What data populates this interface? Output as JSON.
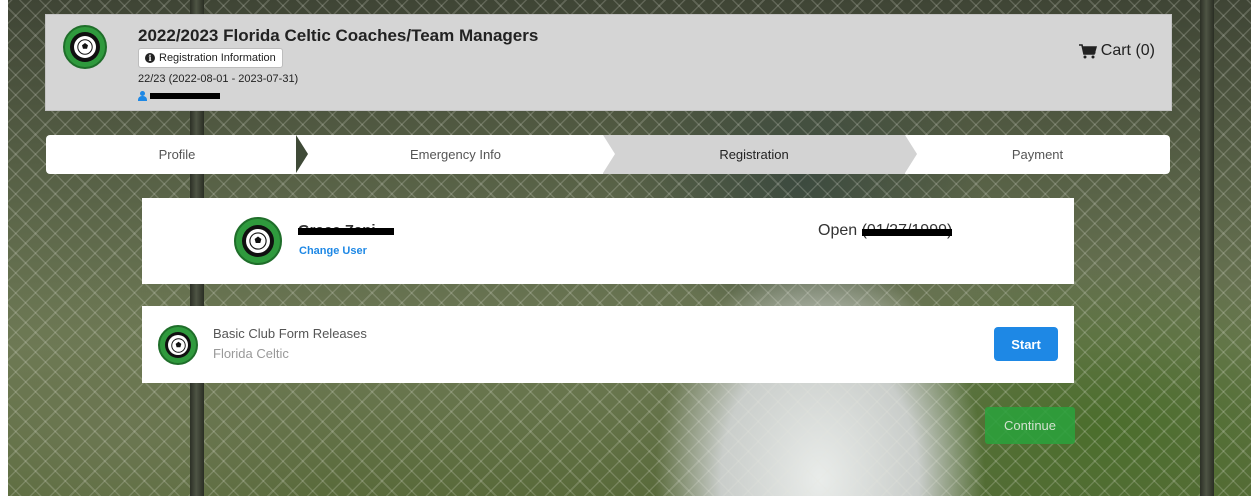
{
  "header": {
    "title": "2022/2023 Florida Celtic Coaches/Team Managers",
    "registration_info_label": "Registration Information",
    "season": "22/23 (2022-08-01 - 2023-07-31)",
    "cart_label": "Cart (0)"
  },
  "steps": [
    {
      "label": "Profile",
      "state": "complete"
    },
    {
      "label": "Emergency Info",
      "state": "complete"
    },
    {
      "label": "Registration",
      "state": "active"
    },
    {
      "label": "Payment",
      "state": "upcoming"
    }
  ],
  "user_card": {
    "name": "Grace Zani",
    "change_user_label": "Change User",
    "status": "Open",
    "dob": "(01/27/1999)"
  },
  "form_item": {
    "title": "Basic Club Form Releases",
    "club": "Florida Celtic",
    "start_label": "Start"
  },
  "continue_label": "Continue",
  "colors": {
    "primary": "#1e88e5",
    "success": "#2aa33c",
    "logo_green": "#2f9a3d",
    "active_step": "#d3d3d3"
  },
  "icons": [
    "info-icon",
    "user-icon",
    "cart-icon",
    "club-logo"
  ]
}
